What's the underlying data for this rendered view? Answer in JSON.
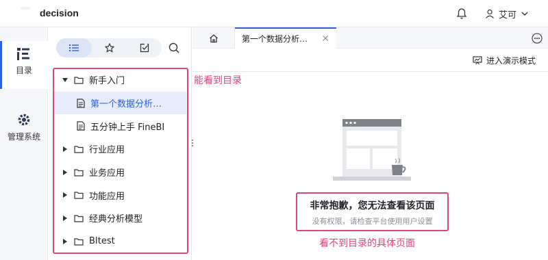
{
  "header": {
    "app_title": "decision",
    "user_name": "艾可",
    "icons": [
      "logo-mark",
      "bell-icon",
      "user-icon",
      "chevron-down-icon"
    ]
  },
  "rail": {
    "items": [
      {
        "label": "目录",
        "icon": "catalog-icon",
        "active": true
      },
      {
        "label": "管理系统",
        "icon": "gear-icon",
        "active": false
      }
    ],
    "accent_color": "#2c60db"
  },
  "directory": {
    "segments": [
      {
        "icon": "list-icon",
        "active": true
      },
      {
        "icon": "star-icon",
        "active": false
      },
      {
        "icon": "check-box-icon",
        "active": false
      }
    ],
    "search_icon": "search-icon",
    "tree": [
      {
        "label": "新手入门",
        "type": "folder",
        "expanded": true,
        "children": [
          {
            "label": "第一个数据分析…",
            "type": "doc",
            "selected": true
          },
          {
            "label": "五分钟上手 FineBI",
            "type": "doc",
            "selected": false
          }
        ]
      },
      {
        "label": "行业应用",
        "type": "folder",
        "expanded": false
      },
      {
        "label": "业务应用",
        "type": "folder",
        "expanded": false
      },
      {
        "label": "功能应用",
        "type": "folder",
        "expanded": false
      },
      {
        "label": "经典分析模型",
        "type": "folder",
        "expanded": false
      },
      {
        "label": "BItest",
        "type": "folder",
        "expanded": false
      }
    ]
  },
  "tabs": {
    "home_icon": "home-icon",
    "active_tab_label": "第一个数据分析…",
    "close_symbol": "✕",
    "more_icon": "more-icon"
  },
  "toolbar": {
    "present_label": "进入演示模式",
    "present_icon": "present-icon"
  },
  "empty_state": {
    "title": "非常抱歉，您无法查看该页面",
    "subtitle": "没有权限，请检查平台使用用户设置"
  },
  "annotations": {
    "left": "能看到目录",
    "bottom": "看不到目录的具体页面",
    "color": "#e0457a"
  }
}
